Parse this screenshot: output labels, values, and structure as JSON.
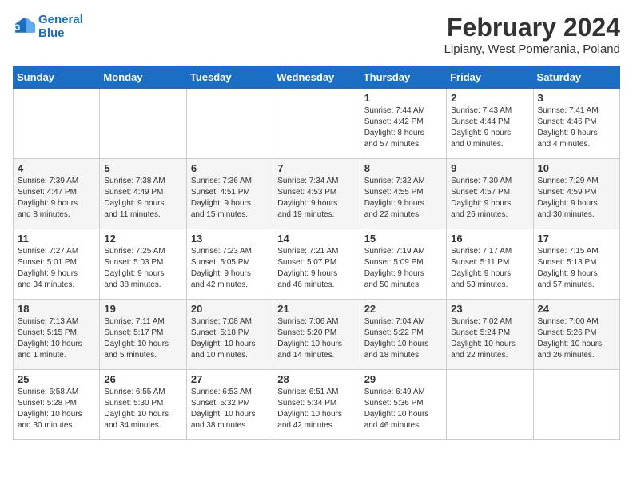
{
  "logo": {
    "line1": "General",
    "line2": "Blue"
  },
  "title": {
    "month_year": "February 2024",
    "location": "Lipiany, West Pomerania, Poland"
  },
  "days_of_week": [
    "Sunday",
    "Monday",
    "Tuesday",
    "Wednesday",
    "Thursday",
    "Friday",
    "Saturday"
  ],
  "weeks": [
    [
      {
        "day": "",
        "content": ""
      },
      {
        "day": "",
        "content": ""
      },
      {
        "day": "",
        "content": ""
      },
      {
        "day": "",
        "content": ""
      },
      {
        "day": "1",
        "content": "Sunrise: 7:44 AM\nSunset: 4:42 PM\nDaylight: 8 hours\nand 57 minutes."
      },
      {
        "day": "2",
        "content": "Sunrise: 7:43 AM\nSunset: 4:44 PM\nDaylight: 9 hours\nand 0 minutes."
      },
      {
        "day": "3",
        "content": "Sunrise: 7:41 AM\nSunset: 4:46 PM\nDaylight: 9 hours\nand 4 minutes."
      }
    ],
    [
      {
        "day": "4",
        "content": "Sunrise: 7:39 AM\nSunset: 4:47 PM\nDaylight: 9 hours\nand 8 minutes."
      },
      {
        "day": "5",
        "content": "Sunrise: 7:38 AM\nSunset: 4:49 PM\nDaylight: 9 hours\nand 11 minutes."
      },
      {
        "day": "6",
        "content": "Sunrise: 7:36 AM\nSunset: 4:51 PM\nDaylight: 9 hours\nand 15 minutes."
      },
      {
        "day": "7",
        "content": "Sunrise: 7:34 AM\nSunset: 4:53 PM\nDaylight: 9 hours\nand 19 minutes."
      },
      {
        "day": "8",
        "content": "Sunrise: 7:32 AM\nSunset: 4:55 PM\nDaylight: 9 hours\nand 22 minutes."
      },
      {
        "day": "9",
        "content": "Sunrise: 7:30 AM\nSunset: 4:57 PM\nDaylight: 9 hours\nand 26 minutes."
      },
      {
        "day": "10",
        "content": "Sunrise: 7:29 AM\nSunset: 4:59 PM\nDaylight: 9 hours\nand 30 minutes."
      }
    ],
    [
      {
        "day": "11",
        "content": "Sunrise: 7:27 AM\nSunset: 5:01 PM\nDaylight: 9 hours\nand 34 minutes."
      },
      {
        "day": "12",
        "content": "Sunrise: 7:25 AM\nSunset: 5:03 PM\nDaylight: 9 hours\nand 38 minutes."
      },
      {
        "day": "13",
        "content": "Sunrise: 7:23 AM\nSunset: 5:05 PM\nDaylight: 9 hours\nand 42 minutes."
      },
      {
        "day": "14",
        "content": "Sunrise: 7:21 AM\nSunset: 5:07 PM\nDaylight: 9 hours\nand 46 minutes."
      },
      {
        "day": "15",
        "content": "Sunrise: 7:19 AM\nSunset: 5:09 PM\nDaylight: 9 hours\nand 50 minutes."
      },
      {
        "day": "16",
        "content": "Sunrise: 7:17 AM\nSunset: 5:11 PM\nDaylight: 9 hours\nand 53 minutes."
      },
      {
        "day": "17",
        "content": "Sunrise: 7:15 AM\nSunset: 5:13 PM\nDaylight: 9 hours\nand 57 minutes."
      }
    ],
    [
      {
        "day": "18",
        "content": "Sunrise: 7:13 AM\nSunset: 5:15 PM\nDaylight: 10 hours\nand 1 minute."
      },
      {
        "day": "19",
        "content": "Sunrise: 7:11 AM\nSunset: 5:17 PM\nDaylight: 10 hours\nand 5 minutes."
      },
      {
        "day": "20",
        "content": "Sunrise: 7:08 AM\nSunset: 5:18 PM\nDaylight: 10 hours\nand 10 minutes."
      },
      {
        "day": "21",
        "content": "Sunrise: 7:06 AM\nSunset: 5:20 PM\nDaylight: 10 hours\nand 14 minutes."
      },
      {
        "day": "22",
        "content": "Sunrise: 7:04 AM\nSunset: 5:22 PM\nDaylight: 10 hours\nand 18 minutes."
      },
      {
        "day": "23",
        "content": "Sunrise: 7:02 AM\nSunset: 5:24 PM\nDaylight: 10 hours\nand 22 minutes."
      },
      {
        "day": "24",
        "content": "Sunrise: 7:00 AM\nSunset: 5:26 PM\nDaylight: 10 hours\nand 26 minutes."
      }
    ],
    [
      {
        "day": "25",
        "content": "Sunrise: 6:58 AM\nSunset: 5:28 PM\nDaylight: 10 hours\nand 30 minutes."
      },
      {
        "day": "26",
        "content": "Sunrise: 6:55 AM\nSunset: 5:30 PM\nDaylight: 10 hours\nand 34 minutes."
      },
      {
        "day": "27",
        "content": "Sunrise: 6:53 AM\nSunset: 5:32 PM\nDaylight: 10 hours\nand 38 minutes."
      },
      {
        "day": "28",
        "content": "Sunrise: 6:51 AM\nSunset: 5:34 PM\nDaylight: 10 hours\nand 42 minutes."
      },
      {
        "day": "29",
        "content": "Sunrise: 6:49 AM\nSunset: 5:36 PM\nDaylight: 10 hours\nand 46 minutes."
      },
      {
        "day": "",
        "content": ""
      },
      {
        "day": "",
        "content": ""
      }
    ]
  ]
}
